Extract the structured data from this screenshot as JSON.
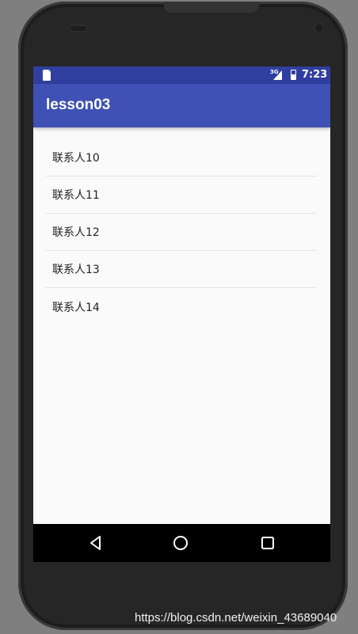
{
  "status_bar": {
    "network": "3G",
    "time": "7:23"
  },
  "app_bar": {
    "title": "lesson03"
  },
  "contacts": [
    {
      "name": "联系人10"
    },
    {
      "name": "联系人11"
    },
    {
      "name": "联系人12"
    },
    {
      "name": "联系人13"
    },
    {
      "name": "联系人14"
    }
  ],
  "nav_bar": {
    "icons": [
      "back-icon",
      "home-icon",
      "recents-icon"
    ]
  },
  "watermark": "https://blog.csdn.net/weixin_43689040",
  "colors": {
    "status_bar": "#303f9f",
    "app_bar": "#3f51b5",
    "background": "#fafafa",
    "nav_bar": "#000000"
  }
}
